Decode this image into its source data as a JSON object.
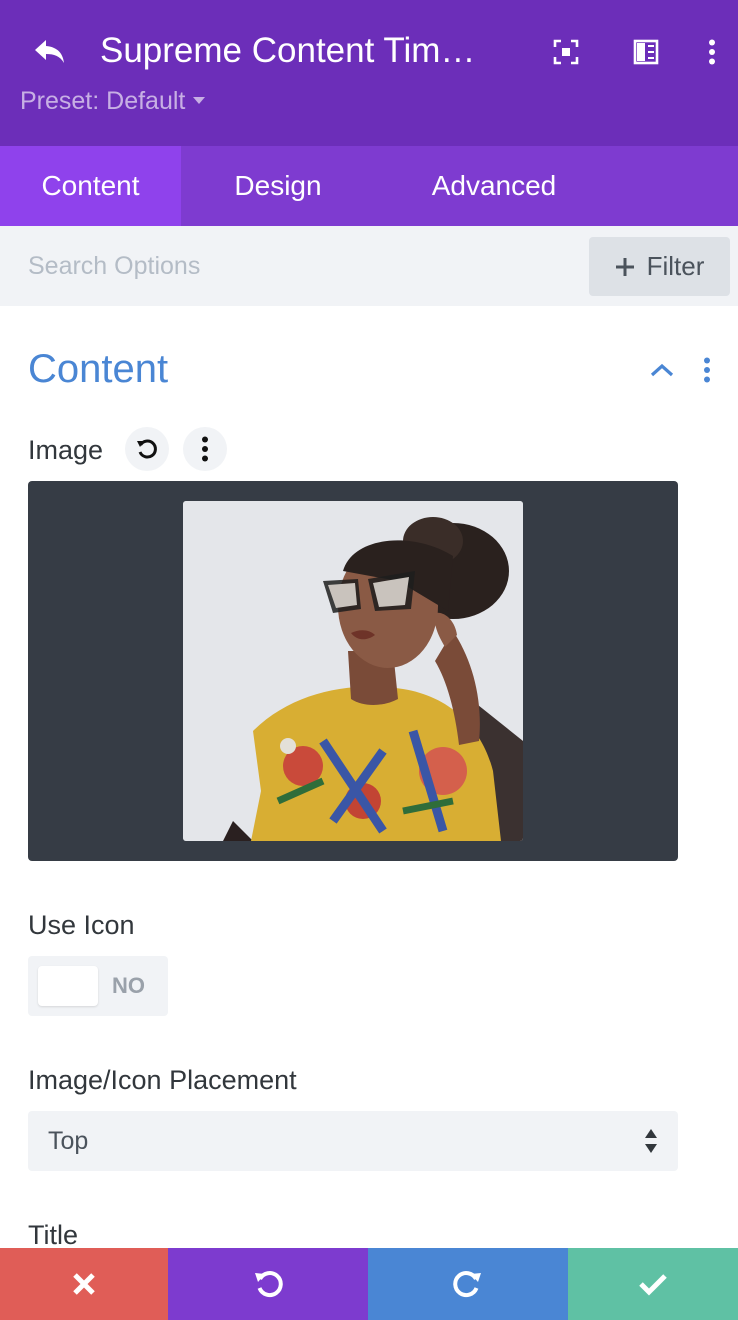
{
  "header": {
    "title": "Supreme Content Tim…",
    "preset_label": "Preset: Default"
  },
  "tabs": [
    {
      "label": "Content",
      "active": true
    },
    {
      "label": "Design",
      "active": false
    },
    {
      "label": "Advanced",
      "active": false
    }
  ],
  "search": {
    "placeholder": "Search Options",
    "filter_label": "Filter"
  },
  "section": {
    "title": "Content"
  },
  "fields": {
    "image_label": "Image",
    "use_icon_label": "Use Icon",
    "use_icon_value": "NO",
    "placement_label": "Image/Icon Placement",
    "placement_value": "Top",
    "title_label": "Title"
  },
  "colors": {
    "header_bg": "#6c2eb9",
    "tabs_bg": "#7e3bd0",
    "tab_active_bg": "#8f42ec",
    "accent_blue": "#4a86d4",
    "discard": "#e05d57",
    "undo": "#7d3bcf",
    "redo": "#4a86d4",
    "save": "#5fc1a4"
  },
  "icons": {
    "back": "back-arrow-icon",
    "focus": "focus-mode-icon",
    "split": "split-view-icon",
    "more": "more-vertical-icon",
    "preset_caret": "caret-down-icon",
    "filter": "plus-icon",
    "collapse": "chevron-up-icon",
    "reset": "reset-icon",
    "discard": "close-icon",
    "undo": "undo-icon",
    "redo": "redo-icon",
    "save": "check-icon"
  }
}
